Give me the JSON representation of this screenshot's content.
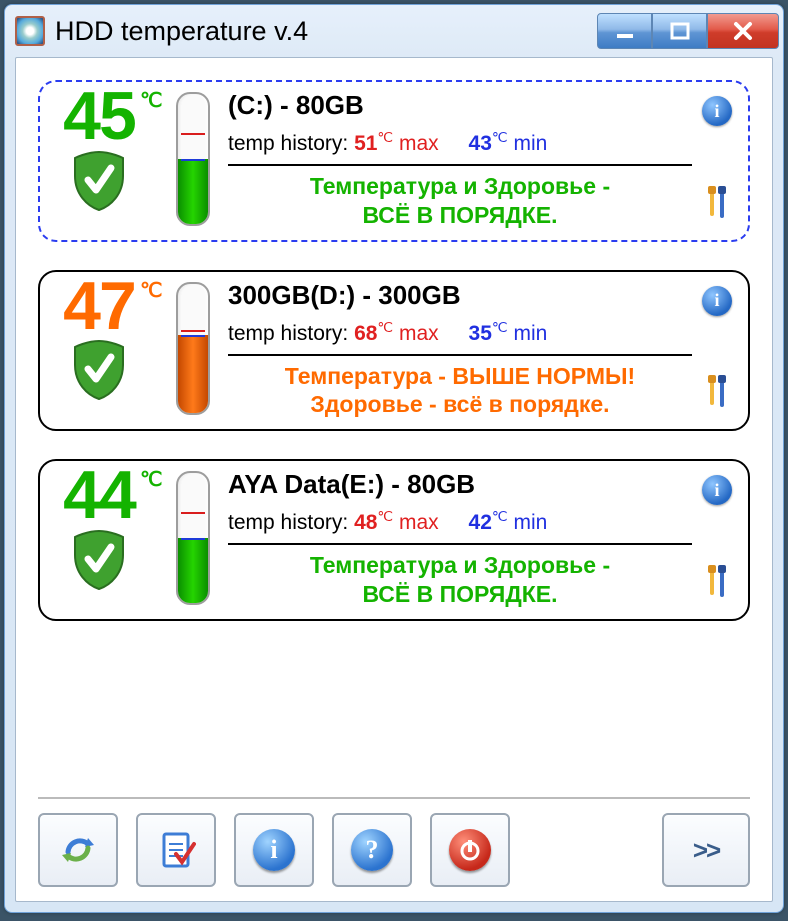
{
  "window": {
    "title": "HDD temperature v.4"
  },
  "drives": [
    {
      "temp": "45",
      "unit": "℃",
      "color": "green",
      "selected": true,
      "title": "(C:) - 80GB",
      "hist_label": "temp history:",
      "max_value": "51",
      "max_unit": "℃",
      "max_word": "max",
      "min_value": "43",
      "min_unit": "℃",
      "min_word": "min",
      "status_line1": "Температура и Здоровье -",
      "status_line2": "ВСЁ В ПОРЯДКЕ.",
      "status_color": "green",
      "thermo_fill_pct": 50,
      "tick_red_pct": 30,
      "tick_blue_pct": 50
    },
    {
      "temp": "47",
      "unit": "℃",
      "color": "orange",
      "selected": false,
      "title": "300GB(D:) - 300GB",
      "hist_label": "temp history:",
      "max_value": "68",
      "max_unit": "℃",
      "max_word": "max",
      "min_value": "35",
      "min_unit": "℃",
      "min_word": "min",
      "status_line1": "Температура - ВЫШЕ НОРМЫ!",
      "status_line2": "Здоровье - всё в порядке.",
      "status_color": "orange",
      "thermo_fill_pct": 60,
      "tick_red_pct": 36,
      "tick_blue_pct": 40
    },
    {
      "temp": "44",
      "unit": "℃",
      "color": "green",
      "selected": false,
      "title": "AYA Data(E:) - 80GB",
      "hist_label": "temp history:",
      "max_value": "48",
      "max_unit": "℃",
      "max_word": "max",
      "min_value": "42",
      "min_unit": "℃",
      "min_word": "min",
      "status_line1": "Температура и Здоровье -",
      "status_line2": "ВСЁ В ПОРЯДКЕ.",
      "status_color": "green",
      "thermo_fill_pct": 50,
      "tick_red_pct": 30,
      "tick_blue_pct": 50
    }
  ],
  "toolbar": {
    "more_label": ">>"
  }
}
